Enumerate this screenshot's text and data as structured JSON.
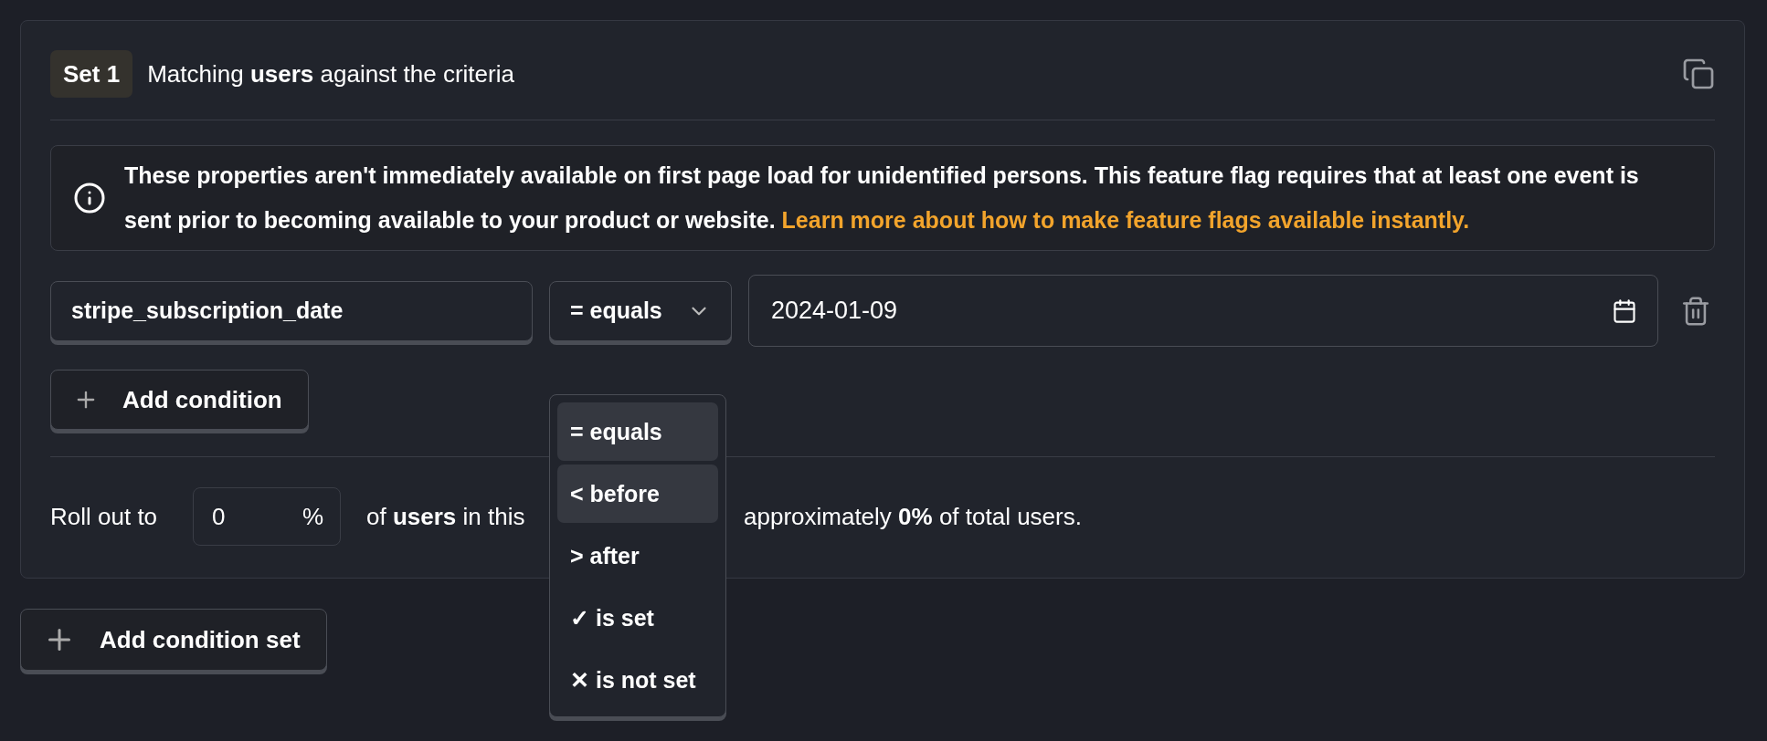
{
  "condition_set": {
    "badge": "Set 1",
    "title": "Matching **users** against the criteria",
    "info": {
      "text": "These properties aren't immediately available on first page load for unidentified persons. This feature flag requires that at least one event is sent prior to becoming available to your product or website.",
      "link": "Learn more about how to make feature flags available instantly."
    },
    "condition": {
      "property": "stripe_subscription_date",
      "operator": "= equals",
      "value": "2024-01-09"
    },
    "add_condition": "Add condition",
    "rollout": {
      "label": "Roll out to",
      "value": "0",
      "unit": "%",
      "text_before": "of **users** in this",
      "text_after": "approximately **0%** of total users."
    },
    "operator_menu": [
      {
        "label": "= equals",
        "highlighted": true
      },
      {
        "label": "< before",
        "highlighted": true
      },
      {
        "label": "> after",
        "highlighted": false
      },
      {
        "label": "✓ is set",
        "highlighted": false
      },
      {
        "label": "✕ is not set",
        "highlighted": false
      }
    ]
  },
  "add_condition_set": "Add condition set"
}
